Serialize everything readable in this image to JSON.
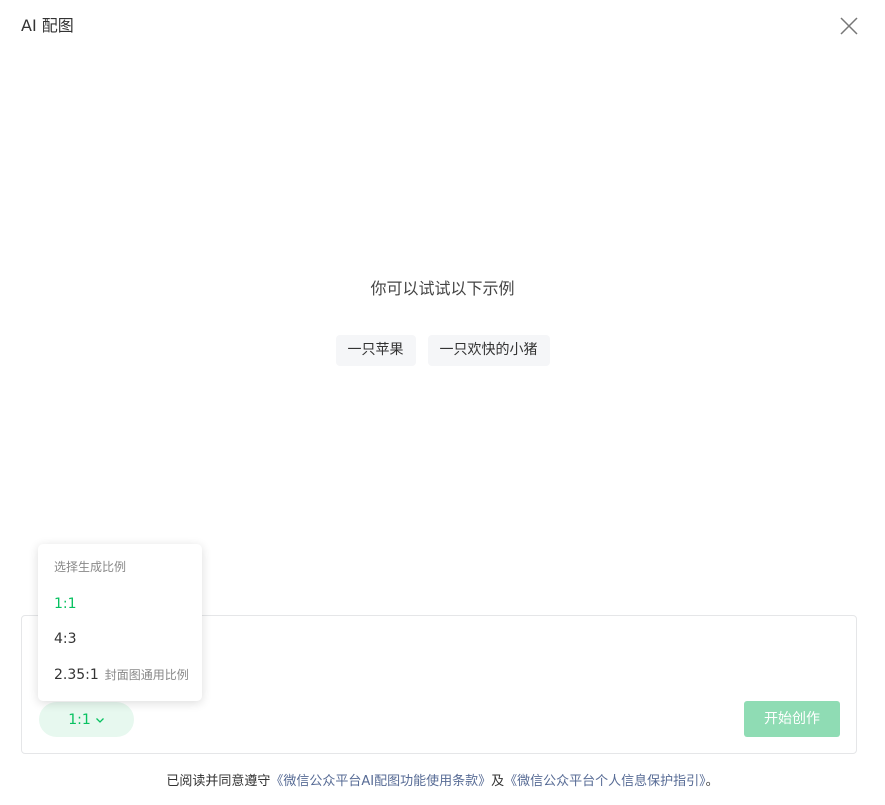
{
  "dialog": {
    "title": "AI 配图",
    "close_icon": "close-icon"
  },
  "prompt_hint": "你可以试试以下示例",
  "examples": [
    {
      "label": "一只苹果"
    },
    {
      "label": "一只欢快的小猪"
    }
  ],
  "ratio_menu": {
    "title": "选择生成比例",
    "options": [
      {
        "label": "1:1",
        "note": "",
        "selected": true
      },
      {
        "label": "4:3",
        "note": "",
        "selected": false
      },
      {
        "label": "2.35:1",
        "note": "封面图通用比例",
        "selected": false
      }
    ]
  },
  "composer": {
    "ratio_value": "1:1",
    "ratio_icon": "chevron-down-icon",
    "start_label": "开始创作"
  },
  "footer": {
    "prefix": "已阅读并同意遵守",
    "link_terms": "《微信公众平台AI配图功能使用条款》",
    "middle": "及",
    "link_privacy": "《微信公众平台个人信息保护指引》",
    "suffix": "。"
  },
  "colors": {
    "accent": "#07c160",
    "accent_light_bg": "#e7f8ef",
    "disabled_button": "#8fdcb4",
    "link": "#576b95"
  }
}
